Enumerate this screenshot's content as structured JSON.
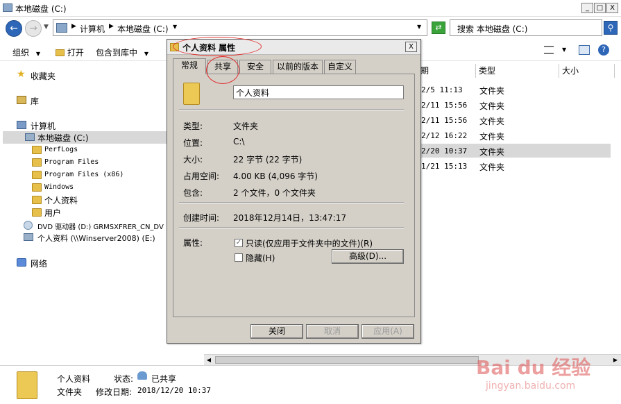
{
  "window": {
    "title": "本地磁盘 (C:)",
    "min": "_",
    "max": "□",
    "close": "X"
  },
  "address": {
    "crumb1": "计算机",
    "crumb2": "本地磁盘 (C:)",
    "search_placeholder": "搜索 本地磁盘 (C:)"
  },
  "toolbar": {
    "organize": "组织",
    "open": "打开",
    "include": "包含到库中"
  },
  "nav": {
    "favorites": "收藏夹",
    "libraries": "库",
    "computer": "计算机",
    "local_disk": "本地磁盘 (C:)",
    "folders": [
      "PerfLogs",
      "Program Files",
      "Program Files (x86)",
      "Windows",
      "个人资料",
      "用户"
    ],
    "dvd": "DVD 驱动器 (D:) GRMSXFRER_CN_DV",
    "network_drive": "个人资料 (\\\\Winserver2008) (E:)",
    "network": "网络"
  },
  "filelist": {
    "headers": [
      "期",
      "类型",
      "大小"
    ],
    "rows": [
      {
        "date": "2/5 11:13",
        "type": "文件夹"
      },
      {
        "date": "2/11 15:56",
        "type": "文件夹"
      },
      {
        "date": "2/11 15:56",
        "type": "文件夹"
      },
      {
        "date": "2/12 16:22",
        "type": "文件夹"
      },
      {
        "date": "2/20 10:37",
        "type": "文件夹"
      },
      {
        "date": "1/21 15:13",
        "type": "文件夹"
      }
    ]
  },
  "dialog": {
    "title": "个人资料 属性",
    "close": "X",
    "tabs": [
      "常规",
      "共享",
      "安全",
      "以前的版本",
      "自定义"
    ],
    "name_value": "个人资料",
    "labels": {
      "type": "类型:",
      "location": "位置:",
      "size": "大小:",
      "disk_size": "占用空间:",
      "contains": "包含:",
      "created": "创建时间:",
      "attributes": "属性:"
    },
    "values": {
      "type": "文件夹",
      "location": "C:\\",
      "size": "22 字节 (22 字节)",
      "disk_size": "4.00 KB (4,096 字节)",
      "contains": "2 个文件，0 个文件夹",
      "created": "2018年12月14日，13:47:17"
    },
    "readonly": "只读(仅应用于文件夹中的文件)(R)",
    "hidden": "隐藏(H)",
    "advanced": "高级(D)...",
    "ok": "关闭",
    "cancel": "取消",
    "apply": "应用(A)"
  },
  "details": {
    "name": "个人资料",
    "state_label": "状态:",
    "state_value": "已共享",
    "type": "文件夹",
    "modified_label": "修改日期:",
    "modified_value": "2018/12/20 10:37"
  },
  "watermark": {
    "brand": "Bai du 经验",
    "url": "jingyan.baidu.com"
  }
}
